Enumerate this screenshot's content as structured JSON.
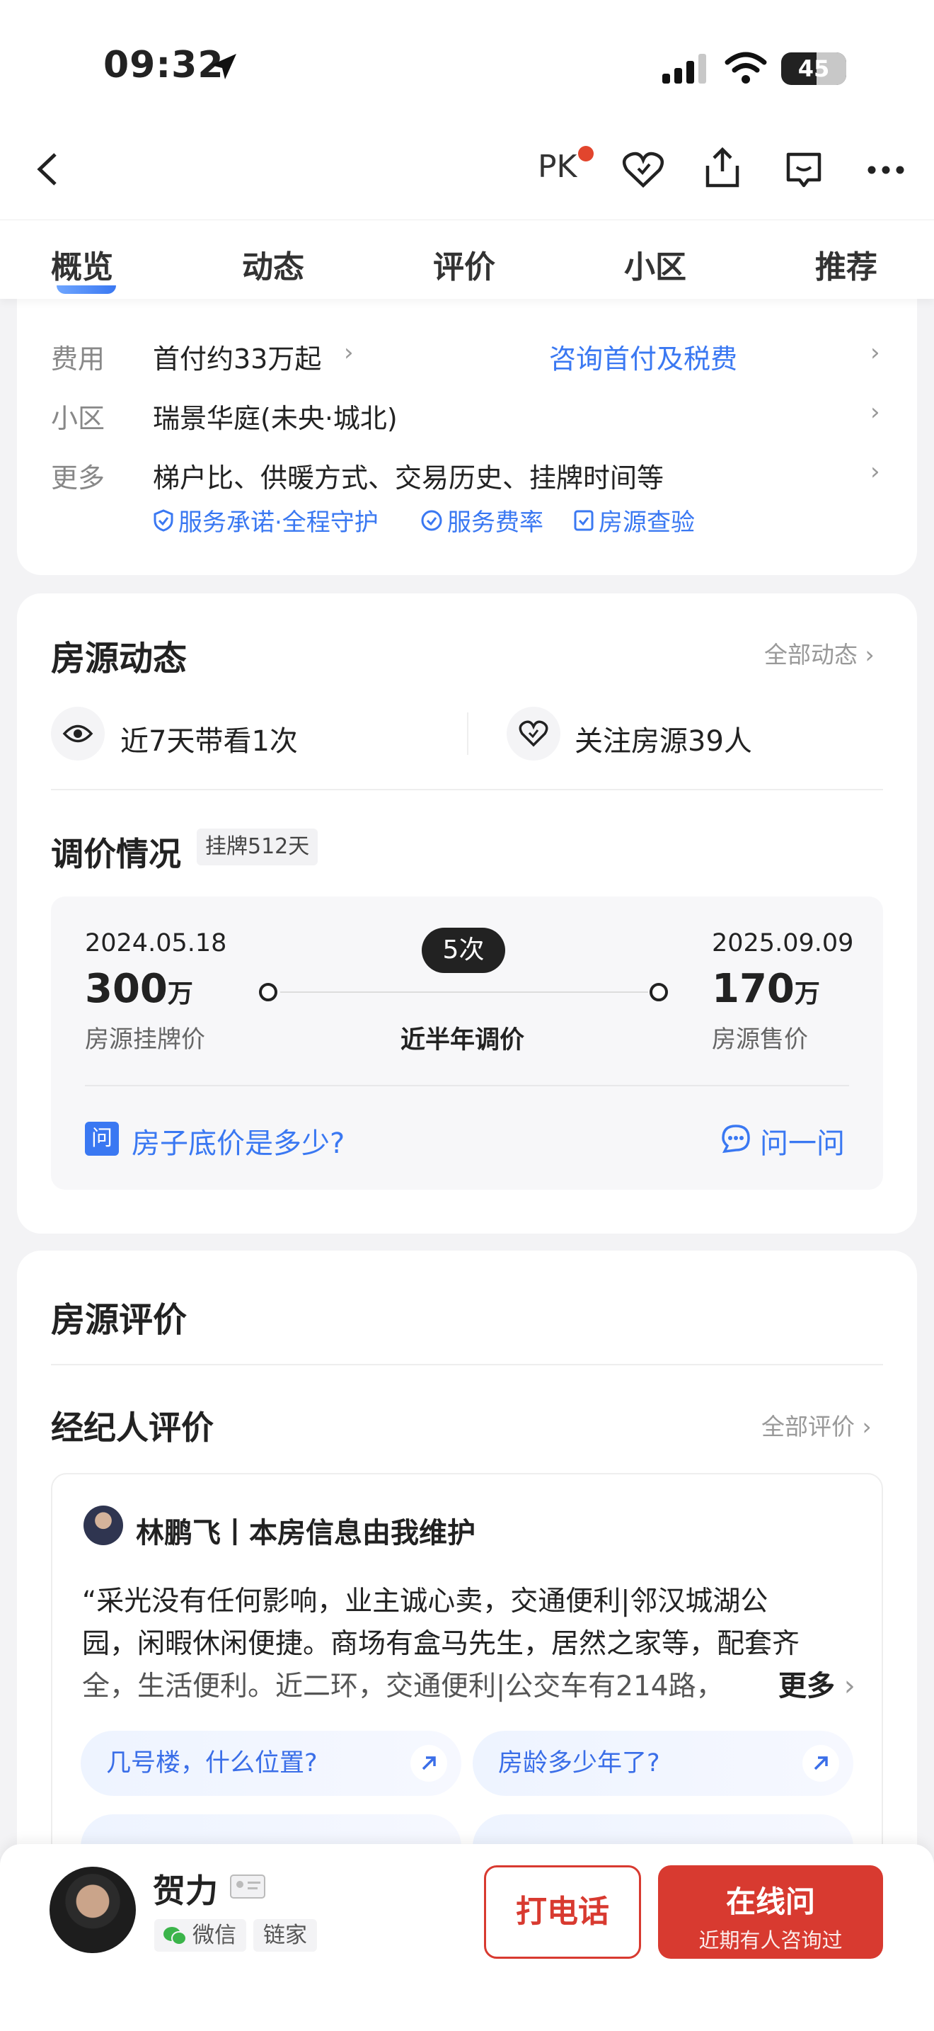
{
  "status_bar": {
    "time": "09:32",
    "battery": "45"
  },
  "nav": {
    "pk_label": "PK"
  },
  "tabs": [
    "概览",
    "动态",
    "评价",
    "小区",
    "推荐"
  ],
  "info_card": {
    "rows": [
      {
        "label": "费用",
        "value": "首付约33万起",
        "link": "咨询首付及税费"
      },
      {
        "label": "小区",
        "value": "瑞景华庭(未央·城北)"
      },
      {
        "label": "更多",
        "value": "梯户比、供暖方式、交易历史、挂牌时间等"
      }
    ],
    "services": [
      "服务承诺·全程守护",
      "服务费率",
      "房源查验"
    ]
  },
  "dynamics": {
    "title": "房源动态",
    "all_link": "全部动态",
    "views": "近7天带看1次",
    "follows": "关注房源39人",
    "price_title": "调价情况",
    "listed_badge": "挂牌512天",
    "start_date": "2024.05.18",
    "start_price": "300",
    "start_unit": "万",
    "start_label": "房源挂牌价",
    "change_count": "5次",
    "change_label": "近半年调价",
    "end_date": "2025.09.09",
    "end_price": "170",
    "end_unit": "万",
    "end_label": "房源售价",
    "question_badge": "问",
    "question": "房子底价是多少?",
    "ask_link": "问一问"
  },
  "evaluation": {
    "title": "房源评价",
    "agent_title": "经纪人评价",
    "all_link": "全部评价",
    "agent_name": "林鹏飞丨本房信息由我维护",
    "text_lines": [
      "“采光没有任何影响，业主诚心卖，交通便利|邻汉城湖公",
      "园，闲暇休闲便捷。商场有盒马先生，居然之家等，配套齐",
      "全，生活便利。近二环，交通便利|公交车有214路，"
    ],
    "more": "更多",
    "chips": [
      "几号楼，什么位置?",
      "房龄多少年了?"
    ]
  },
  "bottom_bar": {
    "agent_name": "贺力",
    "tags": [
      "微信",
      "链家"
    ],
    "call": "打电话",
    "online_title": "在线问",
    "online_sub": "近期有人咨询过"
  }
}
